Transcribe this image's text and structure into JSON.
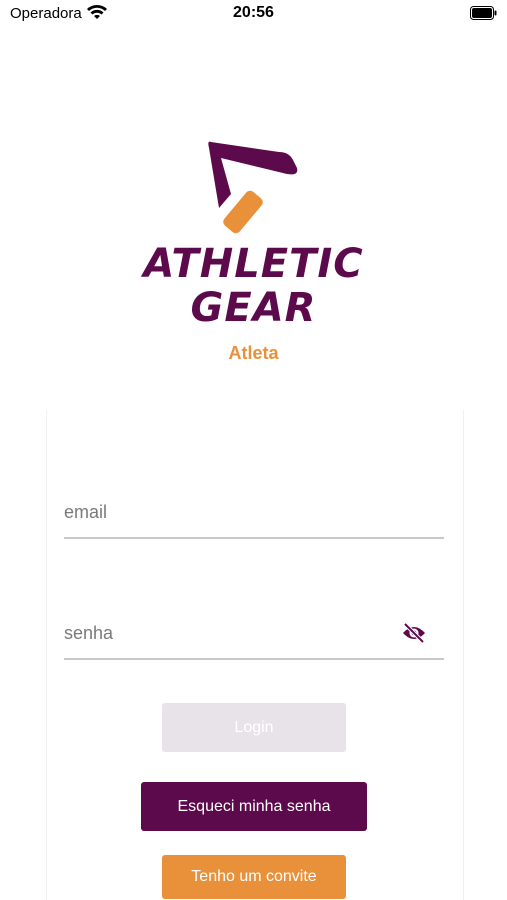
{
  "status_bar": {
    "carrier": "Operadora",
    "time": "20:56"
  },
  "brand": {
    "line1": "ATHLETIC",
    "line2": "GEAR",
    "role": "Atleta",
    "primary_color": "#5d0a4d",
    "accent_color": "#e8913a"
  },
  "form": {
    "email_placeholder": "email",
    "email_value": "",
    "password_placeholder": "senha",
    "password_value": "",
    "password_visibility_icon": "eye-off-icon"
  },
  "buttons": {
    "login": "Login",
    "forgot_password": "Esqueci minha senha",
    "invite": "Tenho um convite"
  }
}
